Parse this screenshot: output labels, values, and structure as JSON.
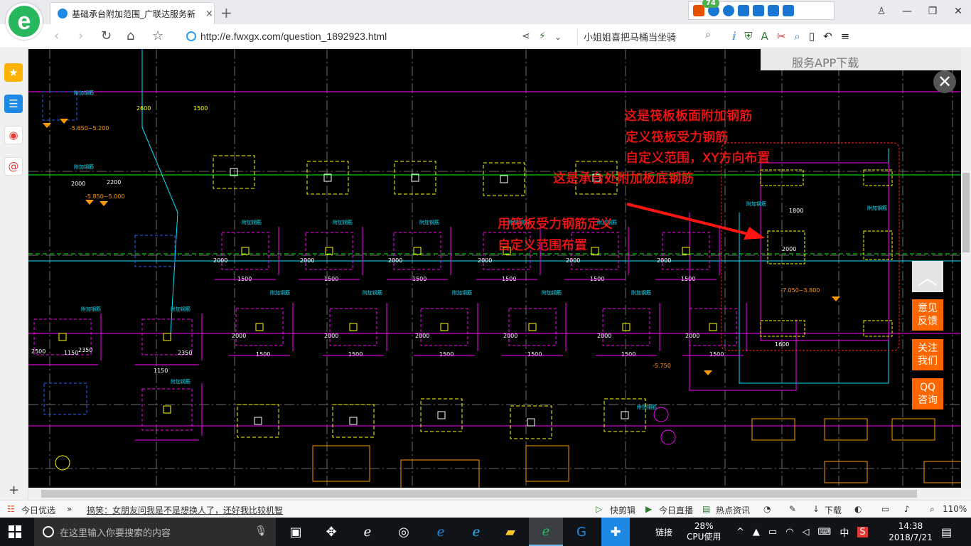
{
  "browser": {
    "tab_title": "基础承台附加范围_广联达服务新",
    "tab_close": "×",
    "new_tab": "+",
    "ext_badge": "74",
    "url": "http://e.fwxgx.com/question_1892923.html",
    "search_text": "小姐姐喜把马桶当坐骑",
    "win_min": "—",
    "win_max": "❐",
    "win_close": "✕"
  },
  "page": {
    "overlay_top_text": "服务APP下载",
    "annotations": [
      "这是筏板板面附加钢筋",
      "定义筏板受力钢筋",
      "自定义范围，XY方向布置",
      "这是承台处附加板底钢筋",
      "用筏板受力钢筋定义",
      "自定义范围布置"
    ],
    "float_buttons": [
      "意见反馈",
      "关注我们",
      "QQ咨询"
    ],
    "close_label": "✕",
    "top_label": "︿"
  },
  "cad": {
    "labels": [
      "-5.650~5.200",
      "-5.850~5.000",
      "-7.050~3.800",
      "-5.750",
      "2600",
      "1500",
      "2000",
      "2200",
      "1450",
      "1150",
      "2350",
      "2700",
      "2750",
      "2500",
      "1600",
      "1800",
      "附加钢筋"
    ]
  },
  "statusbar": {
    "today": "今日优选",
    "news": "搞笑：女朋友问我是不是想换人了，还好我比较机智",
    "quick_clip": "快剪辑",
    "live": "今日直播",
    "hot": "热点资讯",
    "download": "下载",
    "zoom": "110%"
  },
  "taskbar": {
    "search_placeholder": "在这里输入你要搜索的内容",
    "tray_link": "链接",
    "cpu_pct": "28%",
    "cpu_label": "CPU使用",
    "ime": "中",
    "time": "14:38",
    "date": "2018/7/21"
  },
  "colors": {
    "annotation": "#ff1414",
    "float_orange": "#ff6600",
    "cad_bg": "#000000"
  }
}
